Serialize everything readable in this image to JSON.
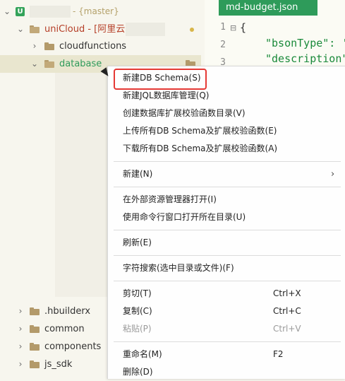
{
  "tree": {
    "project_suffix": "- {master}",
    "uniCloud_label": "uniCloud - [阿里云",
    "items": [
      {
        "label": "cloudfunctions"
      },
      {
        "label": "database"
      }
    ],
    "lower_items": [
      {
        "label": ".hbuilderx"
      },
      {
        "label": "common"
      },
      {
        "label": "components"
      },
      {
        "label": "js_sdk"
      }
    ]
  },
  "editor": {
    "tab_label": "md-budget.json",
    "lines": [
      {
        "num": "1",
        "text": "{"
      },
      {
        "num": "2",
        "text": "\"bsonType\": '"
      },
      {
        "num": "3",
        "text": "\"description\""
      }
    ]
  },
  "menu": {
    "items": [
      {
        "label": "新建DB Schema(S)"
      },
      {
        "label": "新建JQL数据库管理(Q)"
      },
      {
        "label": "创建数据库扩展校验函数目录(V)"
      },
      {
        "label": "上传所有DB Schema及扩展校验函数(E)"
      },
      {
        "label": "下载所有DB Schema及扩展校验函数(A)"
      },
      {
        "label": "新建(N)"
      },
      {
        "label": "在外部资源管理器打开(I)"
      },
      {
        "label": "使用命令行窗口打开所在目录(U)"
      },
      {
        "label": "刷新(E)"
      },
      {
        "label": "字符搜索(选中目录或文件)(F)"
      },
      {
        "label": "剪切(T)",
        "shortcut": "Ctrl+X"
      },
      {
        "label": "复制(C)",
        "shortcut": "Ctrl+C"
      },
      {
        "label": "粘贴(P)",
        "shortcut": "Ctrl+V"
      },
      {
        "label": "重命名(M)",
        "shortcut": "F2"
      },
      {
        "label": "删除(D)"
      }
    ],
    "submenu_arrow": "›"
  },
  "colors": {
    "tab_bg": "#2e9b5a",
    "highlight_border": "#e53935",
    "project_icon": "#34a35a",
    "folder": "#b39a6a"
  }
}
